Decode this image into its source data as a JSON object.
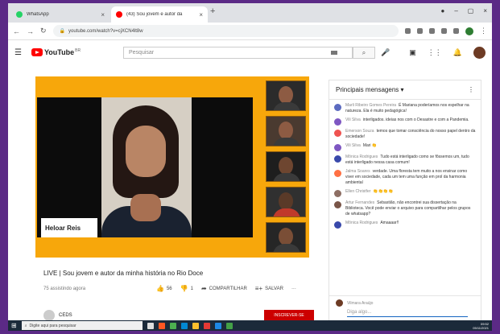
{
  "browser": {
    "tabs": [
      {
        "label": "WhatsApp",
        "color": "#25d366"
      },
      {
        "label": "(43) Sou jovem e autor da",
        "color": "#ff0000"
      }
    ],
    "new_tab": "+",
    "url": "youtube.com/watch?v=cjXCN4lt8w"
  },
  "youtube": {
    "logo_text": "YouTube",
    "logo_sup": "BR",
    "search_placeholder": "Pesquisar"
  },
  "video": {
    "presenter_name": "Heloar Reis",
    "title": "LIVE | Sou jovem e autor da minha história no Rio Doce",
    "date": "75 assistindo agora",
    "likes": "56",
    "dislikes": "1",
    "share": "COMPARTILHAR",
    "save": "SALVAR",
    "more": "···",
    "channel": "CEDS",
    "subscribe": "INSCREVER-SE"
  },
  "chat": {
    "header": "Principais mensagens",
    "messages": [
      {
        "author": "Marli Ribeiro Gomes Pereira",
        "text": "É Mariana poderíamos nos espelhar na natureza. Ela é muito pedagógica!",
        "color": "#5c6bc0"
      },
      {
        "author": "Vili Silva",
        "text": "interligados. ideias nos com o Desastre e com a Pandemia.",
        "color": "#7e57c2"
      },
      {
        "author": "Emerson Souza",
        "text": "temos que tomar consciência do nosso papel dentro da sociedade!",
        "color": "#ef5350"
      },
      {
        "author": "Vili Silva",
        "text": "Mari 👏",
        "color": "#7e57c2"
      },
      {
        "author": "Mônica Rodrigues",
        "text": "Tudo está interligado como se fôssemos um, tudo está interligado nessa casa comum!",
        "color": "#3949ab"
      },
      {
        "author": "Jalma Soares",
        "text": "verdade. Uma floresta tem muito a nos ensinar como viver em sociedade, cada um tem uma função em prol da harmonia ambiental",
        "color": "#ff7043"
      },
      {
        "author": "Ellen Christfer",
        "text": "👏👏👏👏",
        "color": "#8d6e63"
      },
      {
        "author": "Artur Fernandes",
        "text": "Sebastião, não encontrei sua dissertação na Biblioteca. Você pode enviar o arquivo para compartilhar pelos grupos de whatsapp?",
        "color": "#795548"
      },
      {
        "author": "Mônica Rodrigues",
        "text": "Amaaaar!!",
        "color": "#3949ab"
      }
    ],
    "input_user": "Vilmara Araújo",
    "input_placeholder": "Diga algo..."
  },
  "taskbar": {
    "search_placeholder": "Digite aqui para pesquisar",
    "time": "09:52",
    "date": "05/11/2021"
  }
}
